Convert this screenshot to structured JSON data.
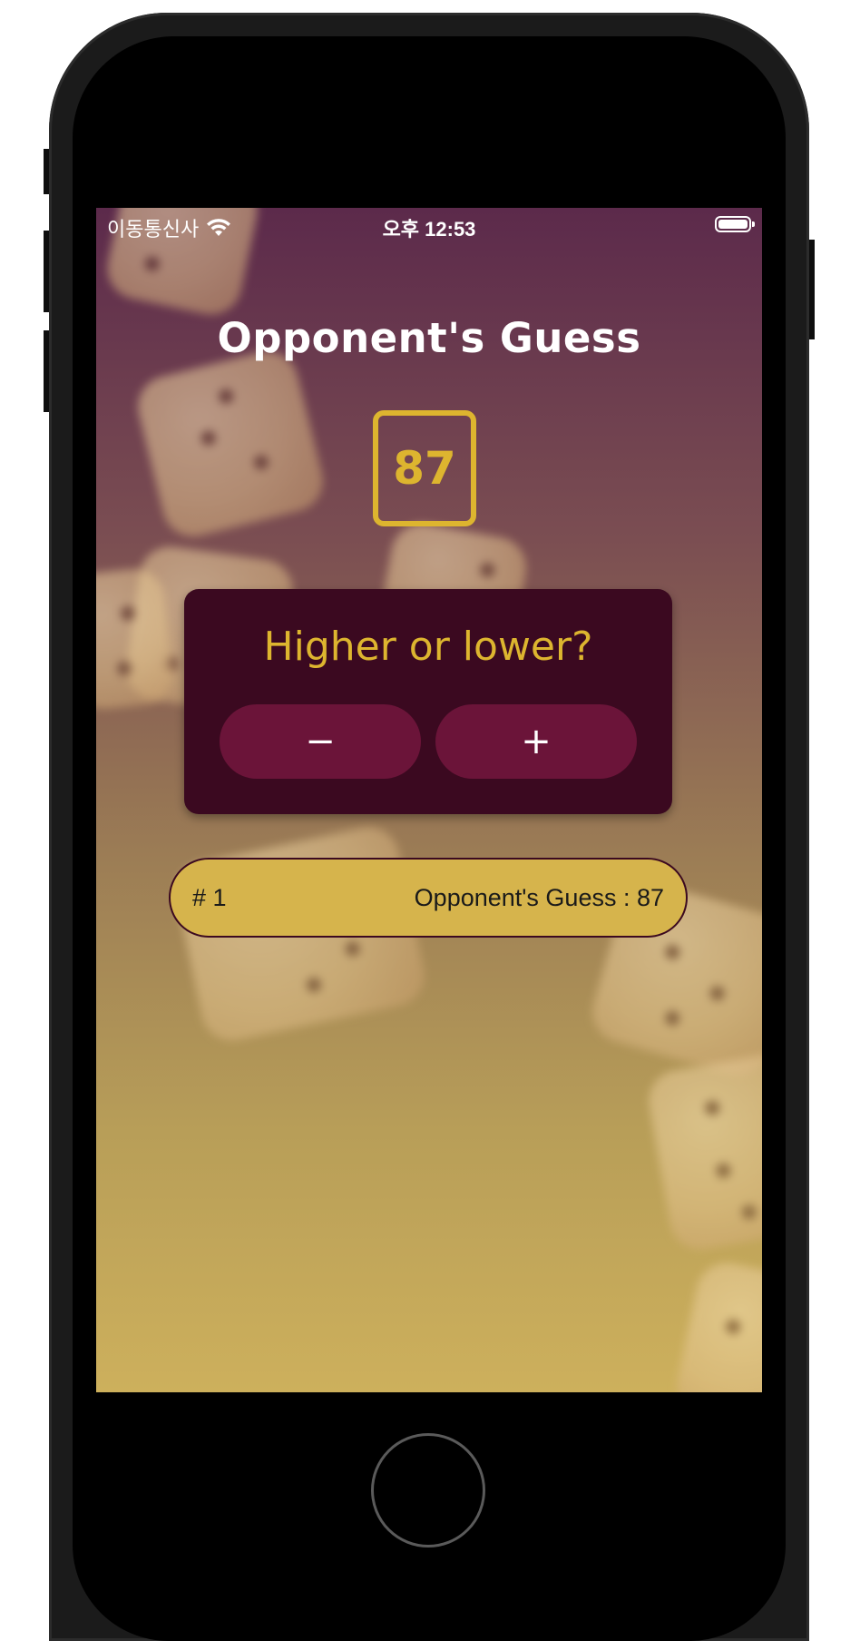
{
  "status_bar": {
    "carrier": "이동통신사",
    "time": "오후 12:53",
    "wifi_icon": "wifi-icon",
    "battery_icon": "battery-icon"
  },
  "screen": {
    "title": "Opponent's Guess",
    "current_guess": "87",
    "prompt": "Higher or lower?",
    "lower_button_label": "−",
    "higher_button_label": "+"
  },
  "guess_log": [
    {
      "round": "# 1",
      "text": "Opponent's Guess : 87"
    }
  ],
  "colors": {
    "accent_gold": "#ddb52f",
    "card_bg": "#3b0920",
    "button_bg": "#6b1439",
    "log_item_bg": "#d6b44c"
  }
}
